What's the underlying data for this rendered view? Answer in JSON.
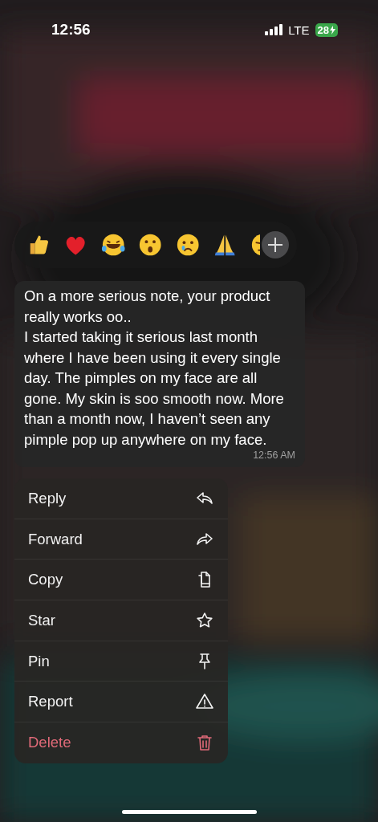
{
  "status_bar": {
    "time": "12:56",
    "network": "LTE",
    "battery": "28"
  },
  "message": {
    "text": "On a more serious note, your product really works oo..\nI started taking it serious last month where I have been using it every single day. The pimples on my face are all gone. My skin is soo smooth now. More than a month now, I haven’t seen any pimple pop up anywhere on my face.",
    "time": "12:56 AM"
  },
  "menu": [
    {
      "label": "Reply",
      "destructive": false
    },
    {
      "label": "Forward",
      "destructive": false
    },
    {
      "label": "Copy",
      "destructive": false
    },
    {
      "label": "Star",
      "destructive": false
    },
    {
      "label": "Pin",
      "destructive": false
    },
    {
      "label": "Report",
      "destructive": false
    },
    {
      "label": "Delete",
      "destructive": true
    }
  ]
}
